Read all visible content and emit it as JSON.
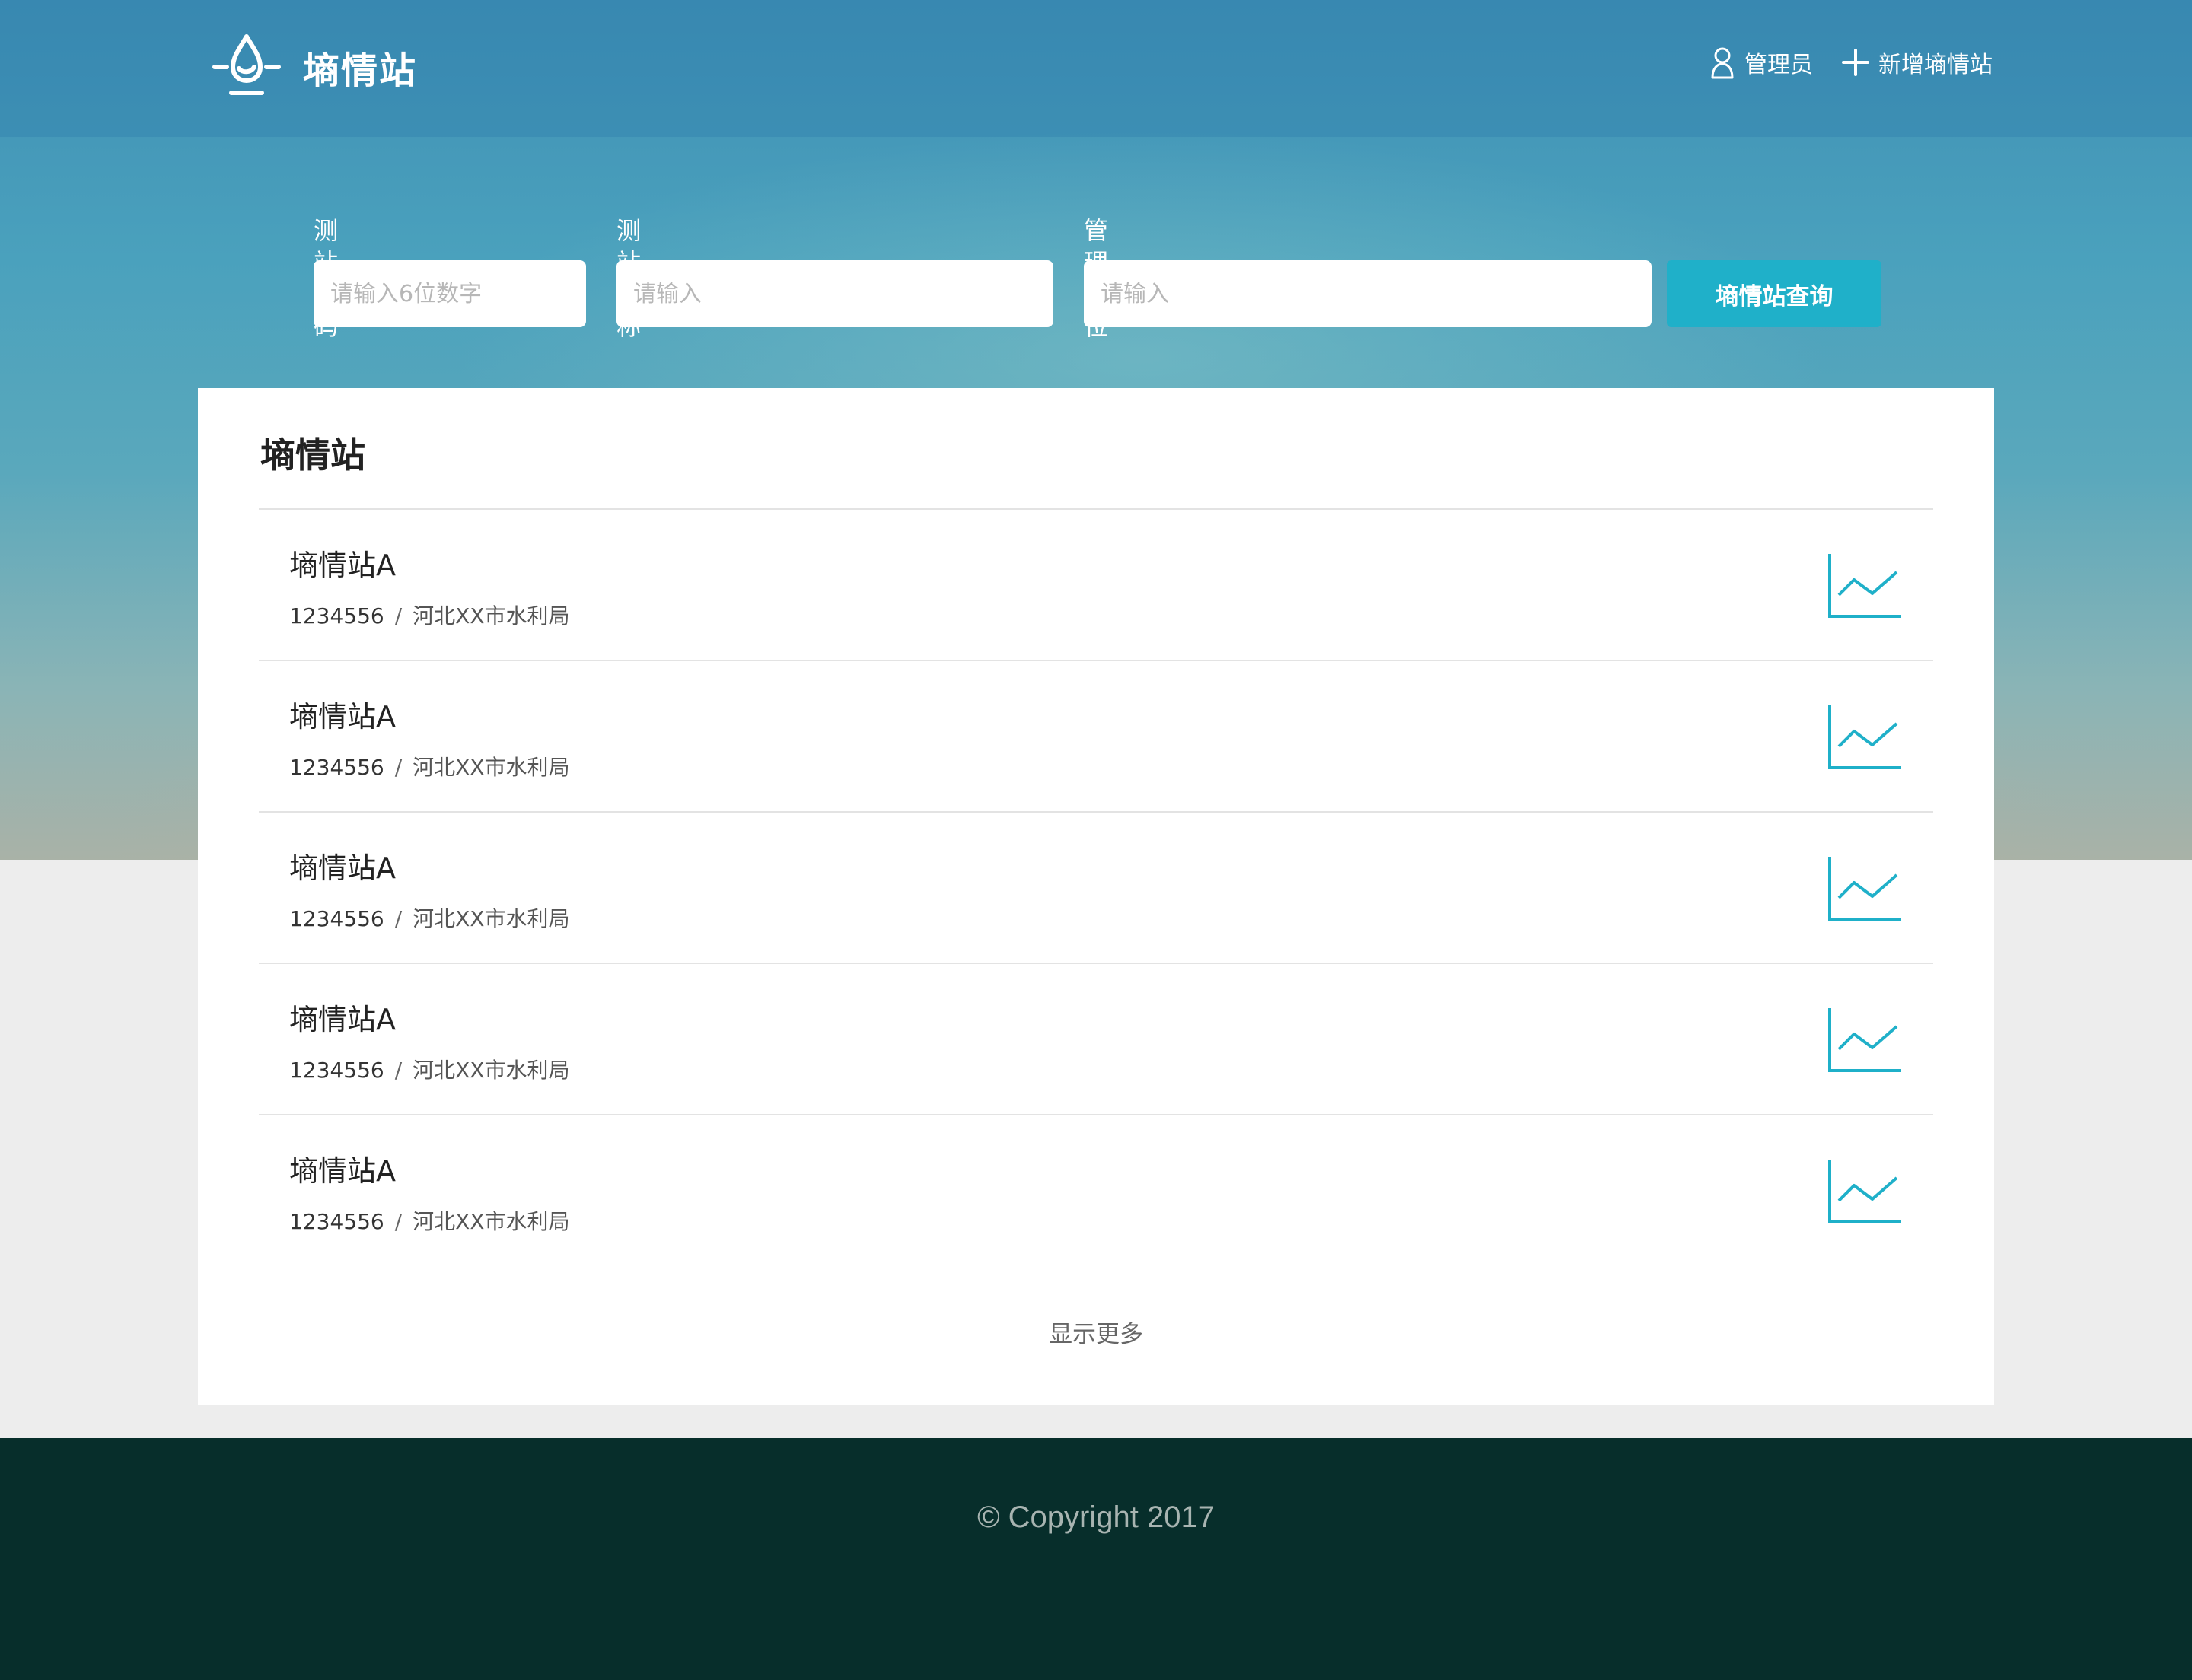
{
  "header": {
    "brand_title": "墒情站",
    "nav": [
      {
        "label": "管理员",
        "icon": "user-icon"
      },
      {
        "label": "新增墒情站",
        "icon": "plus-icon"
      }
    ]
  },
  "search": {
    "fields": [
      {
        "label": "测站编码",
        "placeholder": "请输入6位数字",
        "value": ""
      },
      {
        "label": "测站名称",
        "placeholder": "请输入",
        "value": ""
      },
      {
        "label": "管理单位",
        "placeholder": "请输入",
        "value": ""
      }
    ],
    "button_label": "墒情站查询"
  },
  "list": {
    "title": "墒情站",
    "items": [
      {
        "name": "墒情站A",
        "code": "1234556",
        "separator": "/",
        "unit": "河北XX市水利局"
      },
      {
        "name": "墒情站A",
        "code": "1234556",
        "separator": "/",
        "unit": "河北XX市水利局"
      },
      {
        "name": "墒情站A",
        "code": "1234556",
        "separator": "/",
        "unit": "河北XX市水利局"
      },
      {
        "name": "墒情站A",
        "code": "1234556",
        "separator": "/",
        "unit": "河北XX市水利局"
      },
      {
        "name": "墒情站A",
        "code": "1234556",
        "separator": "/",
        "unit": "河北XX市水利局"
      }
    ],
    "show_more": "显示更多",
    "row_icon": "line-chart-icon"
  },
  "footer": {
    "copyright": "© Copyright 2017"
  },
  "colors": {
    "accent": "#1fb0c9",
    "footer_bg": "#072e2b",
    "page_bg": "#ededed"
  }
}
